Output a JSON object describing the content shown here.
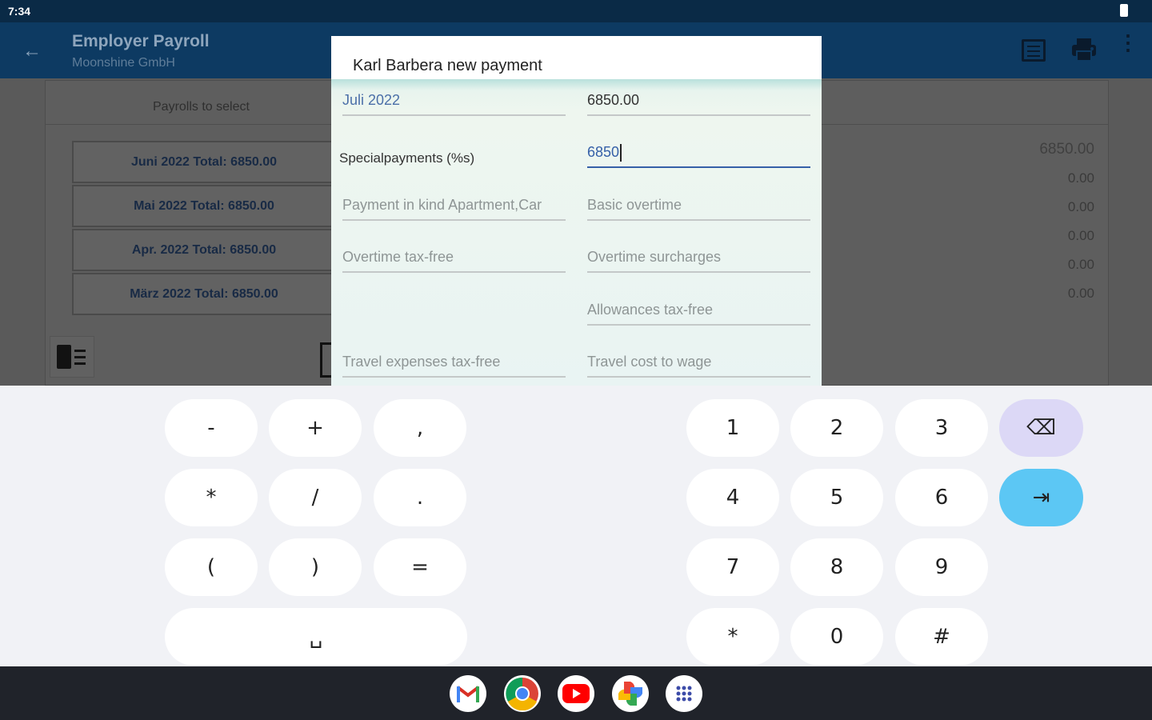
{
  "status_bar": {
    "time": "7:34"
  },
  "app_bar": {
    "title": "Employer Payroll",
    "subtitle": "Moonshine GmbH",
    "icons": [
      "back-arrow-icon",
      "list-icon",
      "print-icon",
      "more-vert-icon"
    ]
  },
  "background": {
    "header": "Payrolls to select",
    "payrolls": [
      "Juni 2022 Total: 6850.00",
      "Mai 2022 Total: 6850.00",
      "Apr. 2022 Total: 6850.00",
      "März 2022 Total: 6850.00"
    ],
    "values": [
      "6850.00",
      "0.00",
      "0.00",
      "0.00",
      "0.00",
      "0.00"
    ]
  },
  "dialog": {
    "title": "Karl Barbera new payment",
    "month": "Juli 2022",
    "month_value": "6850.00",
    "special_label": "Specialpayments (%s)",
    "special_value": "6850",
    "payment_in_kind": "Payment in kind Apartment,Car",
    "basic_overtime": "Basic overtime",
    "overtime_tax_free": "Overtime tax-free",
    "overtime_surcharges": "Overtime surcharges",
    "allowances_tax_free": "Allowances tax-free",
    "travel_expenses_tax_free": "Travel expenses tax-free",
    "travel_cost_to_wage": "Travel cost to wage"
  },
  "keyboard": {
    "symbols": {
      "r1": [
        "-",
        "+",
        ","
      ],
      "r2": [
        "*",
        "/",
        "."
      ],
      "r3": [
        "(",
        ")",
        "="
      ],
      "space": "␣"
    },
    "digits": {
      "r1": [
        "1",
        "2",
        "3"
      ],
      "r2": [
        "4",
        "5",
        "6"
      ],
      "r3": [
        "7",
        "8",
        "9"
      ],
      "r4": [
        "*",
        "0",
        "#"
      ]
    },
    "backspace": "⌫",
    "tab": "⇥"
  },
  "taskbar": {
    "apps": [
      "gmail-icon",
      "chrome-icon",
      "youtube-icon",
      "photos-icon",
      "app-launcher-icon"
    ]
  },
  "colors": {
    "app_bar": "#0d3a62",
    "accent_blue": "#3560a8",
    "tab_key": "#5cc7f4",
    "backspace_key": "#dcd8f6"
  }
}
